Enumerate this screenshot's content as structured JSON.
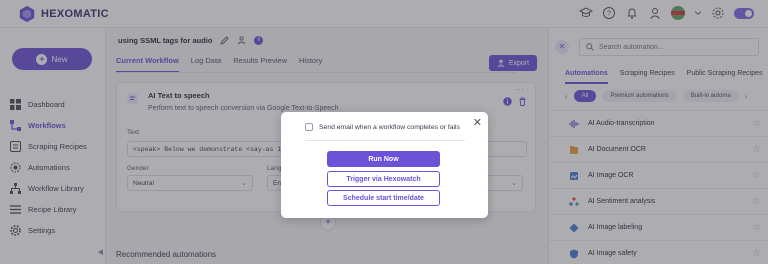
{
  "app": {
    "name": "HEXOMATIC"
  },
  "sidebar": {
    "new_label": "New",
    "items": [
      {
        "label": "Dashboard",
        "icon": "dashboard-icon",
        "active": false
      },
      {
        "label": "Workflows",
        "icon": "workflows-icon",
        "active": true
      },
      {
        "label": "Scraping Recipes",
        "icon": "scraping-recipes-icon",
        "active": false
      },
      {
        "label": "Automations",
        "icon": "automations-icon",
        "active": false
      },
      {
        "label": "Workflow Library",
        "icon": "workflow-library-icon",
        "active": false
      },
      {
        "label": "Recipe Library",
        "icon": "recipe-library-icon",
        "active": false
      },
      {
        "label": "Settings",
        "icon": "settings-icon",
        "active": false
      }
    ]
  },
  "main": {
    "workflow_title": "using SSML tags for audio",
    "tabs": [
      "Current Workflow",
      "Log Data",
      "Results Preview",
      "History"
    ],
    "export_label": "Export",
    "card": {
      "title": "AI Text to speech",
      "description": "Perform text to speech conversion via Google Text-to-Speech",
      "text_label": "Text",
      "text_value": "<speak> Below we demonstrate <say-as interp",
      "gender_label": "Gender",
      "gender_value": "Neutral",
      "language_label": "Lang",
      "language_value": "En"
    },
    "recommended_label": "Recommended automations"
  },
  "right_panel": {
    "search_placeholder": "Search automation...",
    "tabs": [
      "Automations",
      "Scraping Recipes",
      "Public Scraping Recipes"
    ],
    "chips": [
      "All",
      "Premium automations",
      "Built-in automa"
    ],
    "items": [
      "AI Audio-transcription",
      "AI Document OCR",
      "AI Image OCR",
      "AI Sentiment analysis",
      "AI Image labeling",
      "AI Image safety"
    ]
  },
  "modal": {
    "checkbox_label": "Send email when a workflow completes or fails",
    "run_now_label": "Run Now",
    "trigger_label": "Trigger via Hexowatch",
    "schedule_label": "Schedule start time/date"
  },
  "colors": {
    "accent": "#6c52d6",
    "overlay": "#3c3c46"
  }
}
